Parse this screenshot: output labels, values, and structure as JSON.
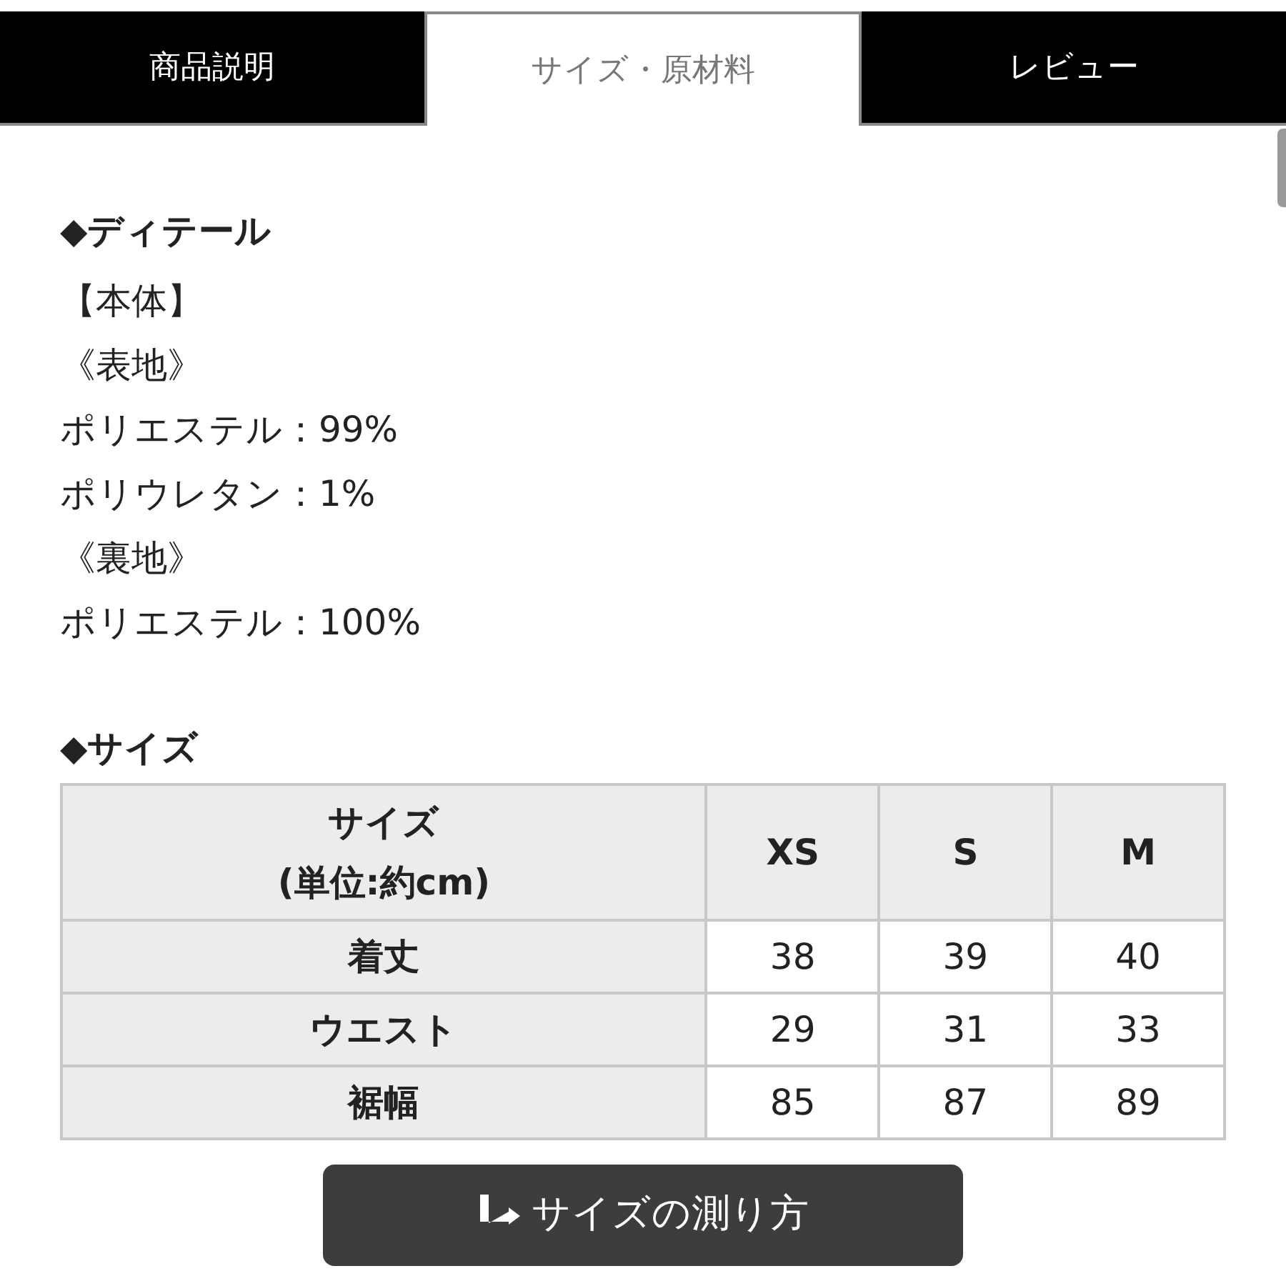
{
  "tabs": [
    {
      "label": "商品説明",
      "selected": false
    },
    {
      "label": "サイズ・原材料",
      "selected": true
    },
    {
      "label": "レビュー",
      "selected": false
    }
  ],
  "detail": {
    "heading": "◆ディテール",
    "lines": [
      "【本体】",
      "《表地》",
      "ポリエステル：99%",
      "ポリウレタン：1%",
      "《裏地》",
      "ポリエステル：100%"
    ]
  },
  "size": {
    "heading": "◆サイズ",
    "table": {
      "columns": [
        "サイズ\n(単位:約cm)",
        "XS",
        "S",
        "M"
      ],
      "rows": [
        [
          "着丈",
          "38",
          "39",
          "40"
        ],
        [
          "ウエスト",
          "29",
          "31",
          "33"
        ],
        [
          "裾幅",
          "85",
          "87",
          "89"
        ]
      ]
    }
  },
  "button": {
    "label": "サイズの測り方"
  }
}
